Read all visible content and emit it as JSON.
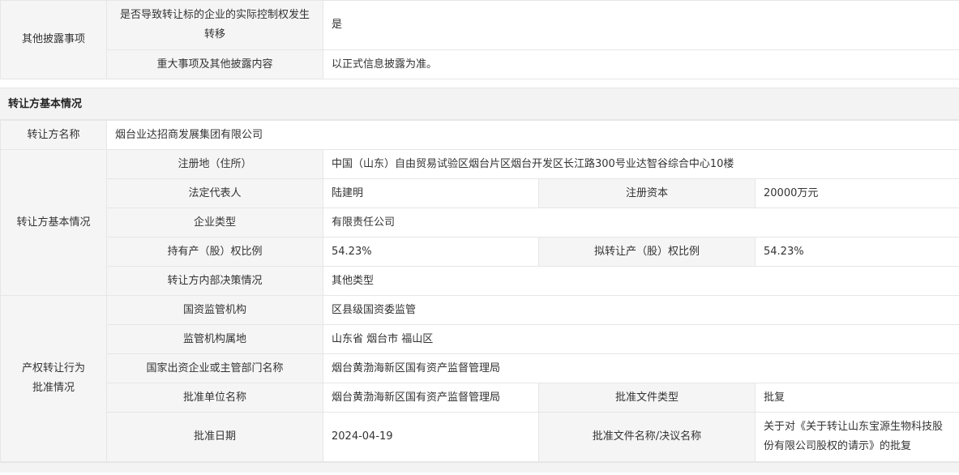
{
  "other": {
    "group_label": "其他披露事项",
    "rows": [
      {
        "label": "是否导致转让标的企业的实际控制权发生转移",
        "value": "是"
      },
      {
        "label": "重大事项及其他披露内容",
        "value": "以正式信息披露为准。"
      }
    ]
  },
  "section_title": "转让方基本情况",
  "transferor": {
    "name_label": "转让方名称",
    "name_value": "烟台业达招商发展集团有限公司",
    "group_label": "转让方基本情况",
    "address_label": "注册地（住所）",
    "address_value": "中国（山东）自由贸易试验区烟台片区烟台开发区长江路300号业达智谷综合中心10楼",
    "legal_rep_label": "法定代表人",
    "legal_rep_value": "陆建明",
    "capital_label": "注册资本",
    "capital_value": "20000万元",
    "type_label": "企业类型",
    "type_value": "有限责任公司",
    "hold_label": "持有产（股）权比例",
    "hold_value": "54.23%",
    "plan_label": "拟转让产（股）权比例",
    "plan_value": "54.23%",
    "decision_label": "转让方内部决策情况",
    "decision_value": "其他类型"
  },
  "approval": {
    "group_label_1": "产权转让行为",
    "group_label_2": "批准情况",
    "agency_label": "国资监管机构",
    "agency_value": "区县级国资委监管",
    "location_label": "监管机构属地",
    "location_value": "山东省 烟台市 福山区",
    "dept_label": "国家出资企业或主管部门名称",
    "dept_value": "烟台黄渤海新区国有资产监督管理局",
    "unit_label": "批准单位名称",
    "unit_value": "烟台黄渤海新区国有资产监督管理局",
    "doc_type_label": "批准文件类型",
    "doc_type_value": "批复",
    "date_label": "批准日期",
    "date_value": "2024-04-19",
    "doc_name_label": "批准文件名称/决议名称",
    "doc_name_value": "关于对《关于转让山东宝源生物科技股份有限公司股权的请示》的批复"
  }
}
